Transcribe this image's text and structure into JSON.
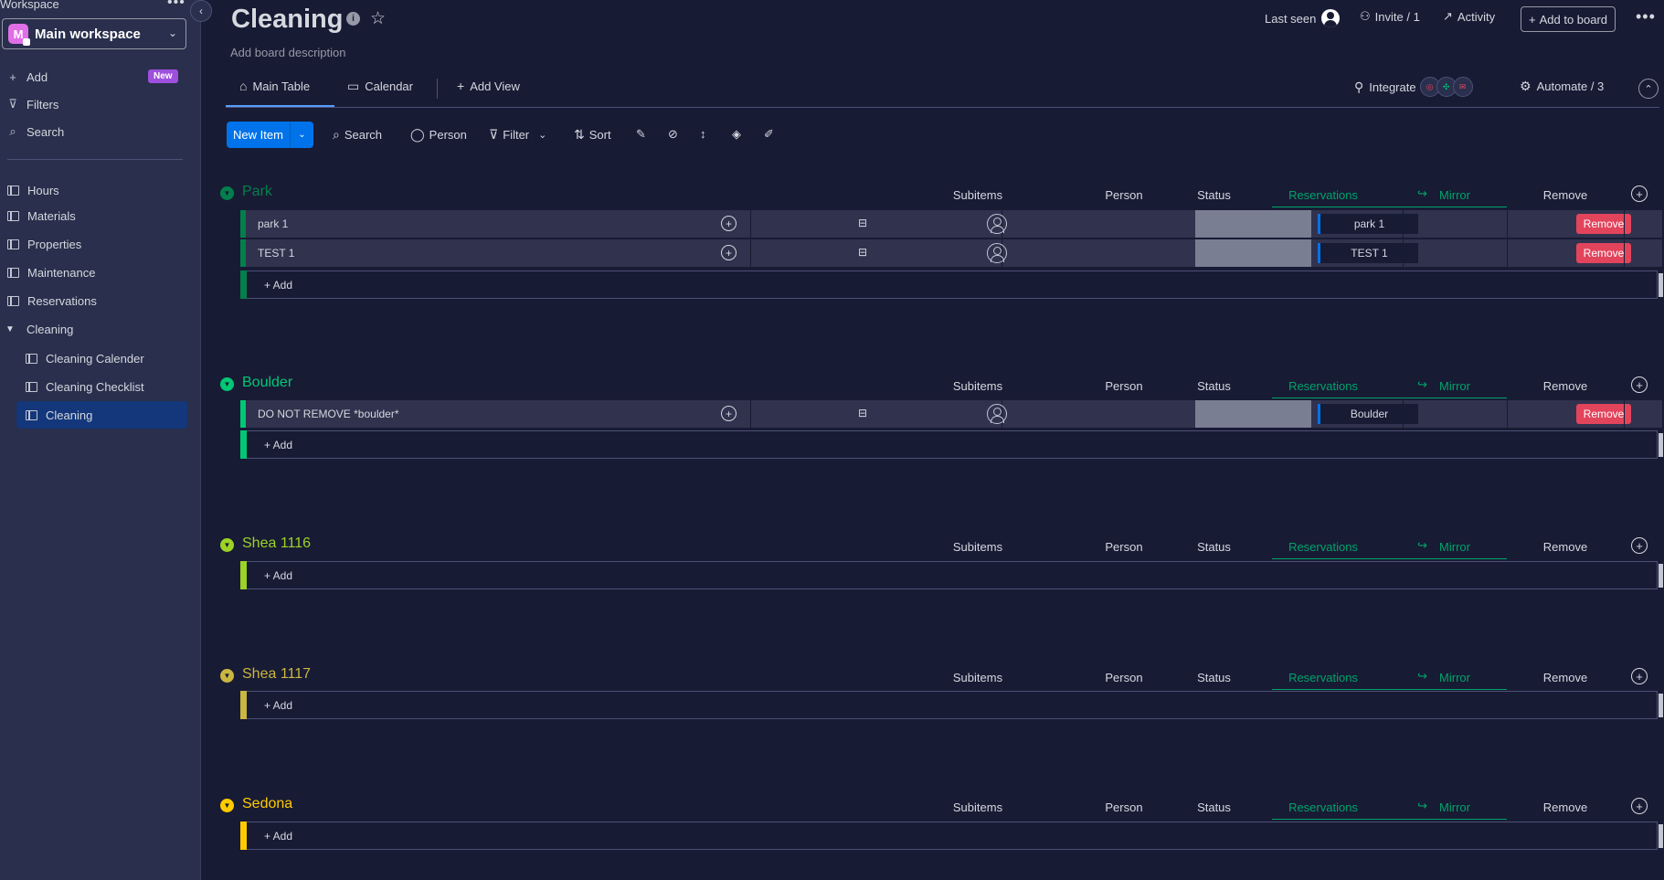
{
  "sidebar": {
    "workspace_label": "Workspace",
    "workspace_avatar": "M",
    "workspace_name": "Main workspace",
    "actions": [
      {
        "label": "Add",
        "icon": "plus-icon"
      },
      {
        "label": "Filters",
        "icon": "filter-icon"
      },
      {
        "label": "Search",
        "icon": "search-icon"
      }
    ],
    "new_badge": "New",
    "boards": [
      "Hours",
      "Materials",
      "Properties",
      "Maintenance",
      "Reservations"
    ],
    "folder": {
      "label": "Cleaning",
      "children": [
        "Cleaning Calender",
        "Cleaning Checklist",
        "Cleaning"
      ]
    }
  },
  "header": {
    "title": "Cleaning",
    "info_glyph": "i",
    "description": "Add board description",
    "last_seen": "Last seen",
    "invite": "Invite / 1",
    "activity": "Activity",
    "add_to_board": "Add to board",
    "more": "•••"
  },
  "tabs": {
    "main_table": "Main Table",
    "calendar": "Calendar",
    "add_view": "Add View",
    "integrate": "Integrate",
    "automate": "Automate / 3"
  },
  "toolbar": {
    "new_item": "New Item",
    "search": "Search",
    "person": "Person",
    "filter": "Filter",
    "sort": "Sort"
  },
  "columns": {
    "subitems": "Subitems",
    "person": "Person",
    "status": "Status",
    "reservations": "Reservations",
    "mirror": "Mirror",
    "remove": "Remove"
  },
  "colors": {
    "park": "#037f4c",
    "boulder": "#00c875",
    "shea_1116": "#9cd326",
    "shea_1117": "#cab641",
    "sedona": "#ffcb00",
    "accent": "#0073ea",
    "remove": "#e2445c"
  },
  "groups": [
    {
      "title": "Park",
      "items": [
        {
          "name": "park 1",
          "reservation": "park 1",
          "remove": "Remove"
        },
        {
          "name": "TEST 1",
          "reservation": "TEST 1",
          "remove": "Remove"
        }
      ],
      "add_label": "+ Add"
    },
    {
      "title": "Boulder",
      "items": [
        {
          "name": "DO NOT REMOVE *boulder*",
          "reservation": "Boulder",
          "remove": "Remove"
        }
      ],
      "add_label": "+ Add"
    },
    {
      "title": "Shea 1116",
      "items": [],
      "add_label": "+ Add"
    },
    {
      "title": "Shea 1117",
      "items": [],
      "add_label": "+ Add"
    },
    {
      "title": "Sedona",
      "items": [],
      "add_label": "+ Add"
    }
  ]
}
